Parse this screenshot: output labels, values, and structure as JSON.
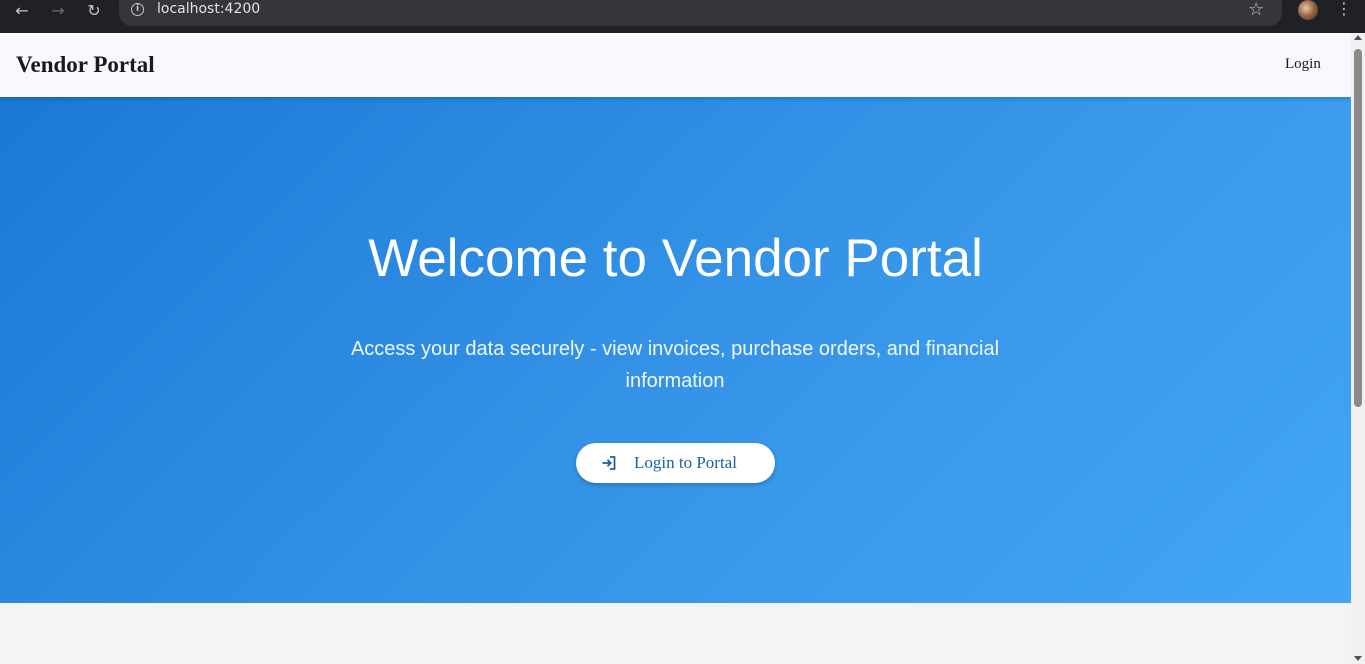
{
  "browser": {
    "url": "localhost:4200",
    "back_icon": "arrow-left-icon",
    "forward_icon": "arrow-right-icon",
    "reload_icon": "reload-icon",
    "info_icon": "info-icon",
    "star_icon": "star-icon",
    "menu_icon": "kebab-menu-icon"
  },
  "header": {
    "brand": "Vendor Portal",
    "login_link": "Login",
    "background": "#f8f8ff"
  },
  "hero": {
    "title": "Welcome to Vendor Portal",
    "subtitle": "Access your data securely - view invoices, purchase orders, and financial information",
    "cta_label": "Login to Portal",
    "cta_icon": "login-icon",
    "gradient_start": "#1b79d6",
    "gradient_end": "#42a5f5"
  }
}
